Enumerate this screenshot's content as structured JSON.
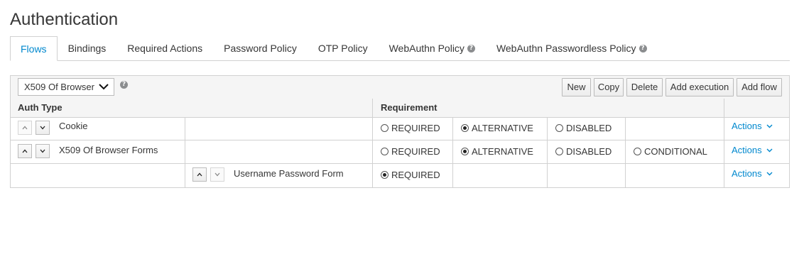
{
  "page": {
    "title": "Authentication"
  },
  "tabs": [
    {
      "label": "Flows",
      "active": true,
      "help": false
    },
    {
      "label": "Bindings",
      "active": false,
      "help": false
    },
    {
      "label": "Required Actions",
      "active": false,
      "help": false
    },
    {
      "label": "Password Policy",
      "active": false,
      "help": false
    },
    {
      "label": "OTP Policy",
      "active": false,
      "help": false
    },
    {
      "label": "WebAuthn Policy",
      "active": false,
      "help": true
    },
    {
      "label": "WebAuthn Passwordless Policy",
      "active": false,
      "help": true
    }
  ],
  "toolbar": {
    "selected_flow": "X509 Of Browser",
    "buttons": {
      "new": "New",
      "copy": "Copy",
      "delete": "Delete",
      "add_execution": "Add execution",
      "add_flow": "Add flow"
    }
  },
  "table": {
    "headers": {
      "auth_type": "Auth Type",
      "requirement": "Requirement"
    },
    "rows": [
      {
        "name": "Cookie",
        "options": {
          "required": "REQUIRED",
          "alternative": "ALTERNATIVE",
          "disabled": "DISABLED"
        },
        "selected": "ALTERNATIVE",
        "actions": "Actions"
      },
      {
        "name": "X509 Of Browser Forms",
        "options": {
          "required": "REQUIRED",
          "alternative": "ALTERNATIVE",
          "disabled": "DISABLED",
          "conditional": "CONDITIONAL"
        },
        "selected": "ALTERNATIVE",
        "actions": "Actions"
      },
      {
        "name": "Username Password Form",
        "options": {
          "required": "REQUIRED"
        },
        "selected": "REQUIRED",
        "actions": "Actions"
      }
    ]
  },
  "colors": {
    "link": "#0088ce",
    "border": "#d1d1d1",
    "header_bg": "#f5f5f5"
  }
}
